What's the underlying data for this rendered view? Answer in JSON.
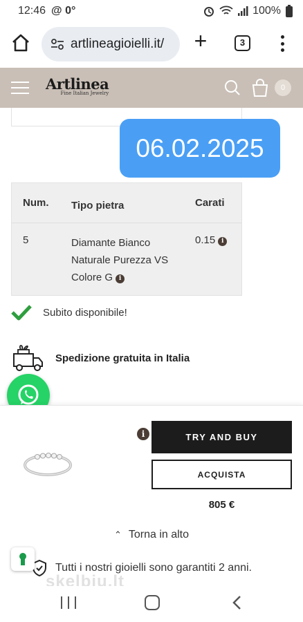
{
  "status_bar": {
    "time": "12:46",
    "extra": "@ 0°",
    "battery": "100%"
  },
  "browser": {
    "url": "artlineagioielli.it/",
    "tab_count": "3"
  },
  "site": {
    "brand": "Artlinea",
    "tagline": "Fine Italian Jewelry",
    "cart_count": "0"
  },
  "overlay": {
    "date": "06.02.2025"
  },
  "stone_table": {
    "headers": [
      "Num.",
      "Tipo pietra",
      "Carati"
    ],
    "rows": [
      {
        "num": "5",
        "type": "Diamante Bianco Naturale Purezza VS Colore G",
        "carats": "0.15"
      }
    ]
  },
  "availability": "Subito disponibile!",
  "shipping": "Spedizione gratuita in Italia",
  "buy_bar": {
    "try_label": "TRY AND BUY",
    "buy_label": "ACQUISTA",
    "price": "805 €",
    "back_to_top": "Torna in alto",
    "guarantee": "Tutti i nostri gioielli sono garantiti 2 anni."
  },
  "watermark": "skelbiu.lt",
  "colors": {
    "header_bg": "#c9bfb6",
    "date_bubble": "#4a9ff5",
    "button_dark": "#1c1c1c",
    "whatsapp": "#25d366",
    "check_green": "#2e9e3e"
  }
}
